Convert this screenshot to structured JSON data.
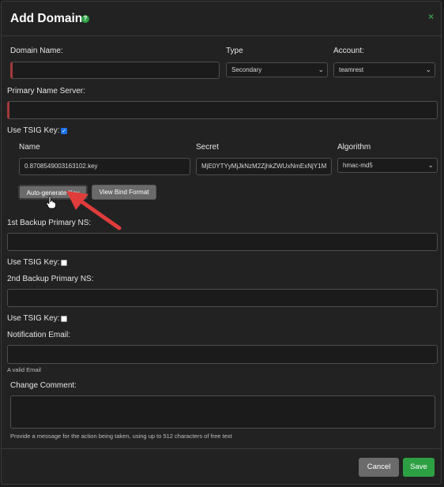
{
  "modal": {
    "title": "Add Domain",
    "help_icon_glyph": "?",
    "close_icon_glyph": "×"
  },
  "form": {
    "domain_name_label": "Domain Name:",
    "domain_name_value": "",
    "type_label": "Type",
    "type_selected": "Secondary",
    "account_label": "Account:",
    "account_selected": "teamrest",
    "primary_ns_label": "Primary Name Server:",
    "primary_ns_value": "",
    "use_tsig_label": "Use TSIG Key:",
    "use_tsig_checked": true,
    "tsig": {
      "name_label": "Name",
      "name_value": "0.8708549003163102.key",
      "secret_label": "Secret",
      "secret_value": "MjE0YTYyMjJkNzM2ZjhkZWUxNmExNjY1M",
      "algorithm_label": "Algorithm",
      "algorithm_selected": "hmac-md5",
      "autogen_button": "Auto-generate Key",
      "view_bind_button": "View Bind Format"
    },
    "backup1_label": "1st Backup Primary NS:",
    "backup1_value": "",
    "backup1_tsig_label": "Use TSIG Key:",
    "backup1_tsig_checked": false,
    "backup2_label": "2nd Backup Primary NS:",
    "backup2_value": "",
    "backup2_tsig_label": "Use TSIG Key:",
    "backup2_tsig_checked": false,
    "notification_label": "Notification Email:",
    "notification_value": "",
    "notification_hint": "A valid Email",
    "comment_label": "Change Comment:",
    "comment_hint": "Provide a message for the action being taken, using up to 512 characters of free text"
  },
  "footer": {
    "cancel_label": "Cancel",
    "save_label": "Save"
  },
  "colors": {
    "accent_green": "#2ea044",
    "required_red": "#a23a3a",
    "checkbox_blue": "#1a73e8",
    "arrow_red": "#e03c3c"
  },
  "icons": [
    "help-icon",
    "close-icon",
    "chevron-down-icon",
    "checkmark-icon",
    "hand-cursor-icon",
    "red-arrow-annotation"
  ]
}
